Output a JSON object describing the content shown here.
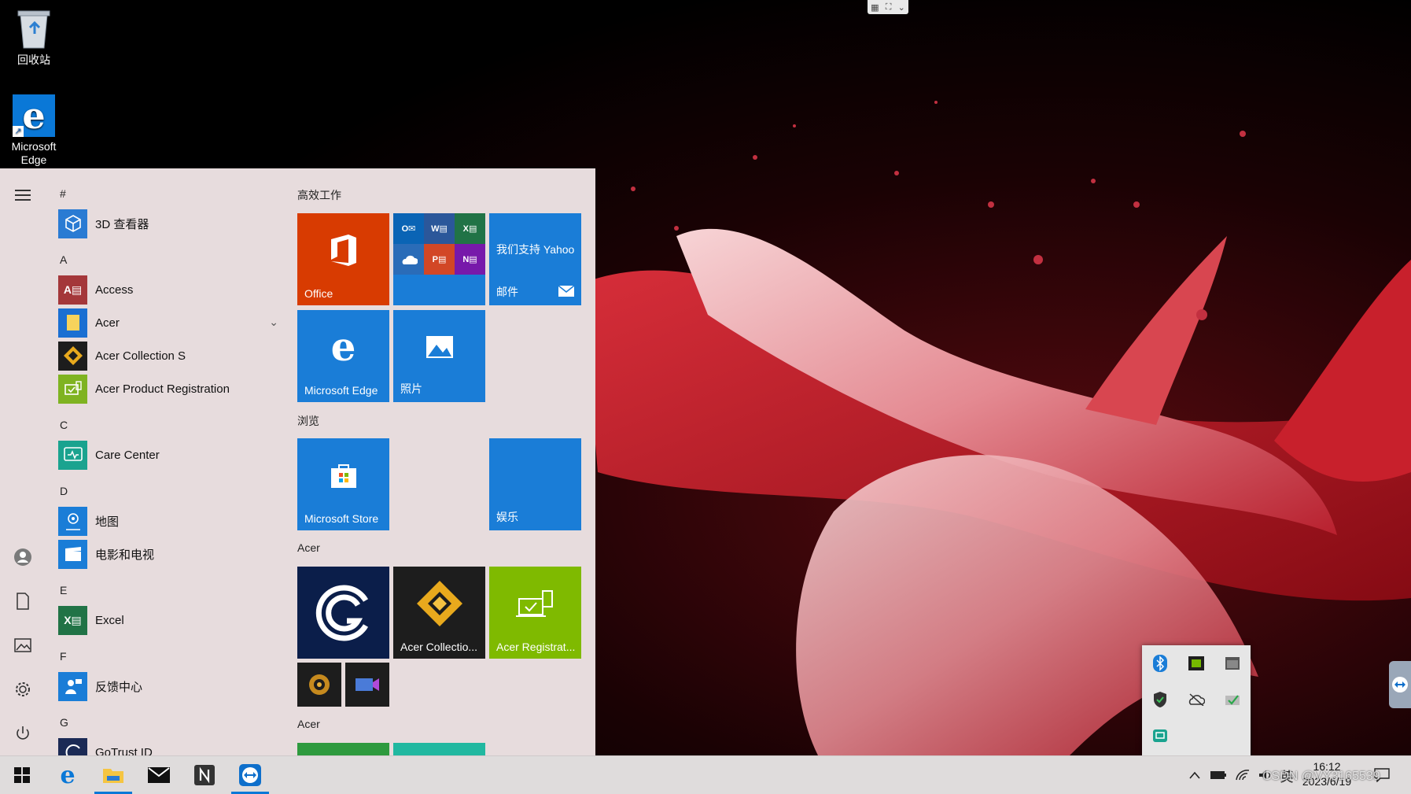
{
  "desktop": {
    "icons": [
      {
        "label": "回收站",
        "icon": "recycle-bin-icon"
      },
      {
        "label": "Microsoft Edge",
        "icon": "edge-icon"
      }
    ]
  },
  "start_menu": {
    "rail": [
      "hamburger-menu-icon",
      "user-avatar-icon",
      "documents-icon",
      "pictures-icon",
      "settings-gear-icon",
      "power-icon"
    ],
    "letters": [
      "#",
      "A",
      "C",
      "D",
      "E",
      "F",
      "G"
    ],
    "apps": [
      {
        "label": "3D 查看器",
        "color": "#2a7bd3"
      },
      {
        "label": "Access",
        "color": "#a4373a"
      },
      {
        "label": "Acer",
        "color": "#1a6fd2",
        "expandable": true
      },
      {
        "label": "Acer Collection S",
        "color": "#1d1d1d"
      },
      {
        "label": "Acer Product Registration",
        "color": "#7fb321"
      },
      {
        "label": "Care Center",
        "color": "#1aa38f"
      },
      {
        "label": "地图",
        "color": "#1a7dd7"
      },
      {
        "label": "电影和电视",
        "color": "#1a7dd7"
      },
      {
        "label": "Excel",
        "color": "#217346"
      },
      {
        "label": "反馈中心",
        "color": "#1a7dd7"
      },
      {
        "label": "GoTrust ID",
        "color": "#1b2a55"
      }
    ],
    "groups": [
      "高效工作",
      "浏览",
      "Acer",
      "Acer"
    ],
    "tiles": {
      "office": "Office",
      "yahoo_text": "我们支持 Yahoo",
      "mail": "邮件",
      "edge": "Microsoft Edge",
      "photos": "照片",
      "store": "Microsoft Store",
      "entertainment": "娱乐",
      "acer_collection": "Acer Collectio...",
      "acer_registration": "Acer Registrat..."
    }
  },
  "taskbar": {
    "ime": "英",
    "time": "16:12",
    "date": "2023/6/19",
    "watermark": "CSDN @VY3165539"
  },
  "colors": {
    "accent": "#0078d7",
    "office": "#d83b01",
    "acer_green": "#7fba00"
  }
}
